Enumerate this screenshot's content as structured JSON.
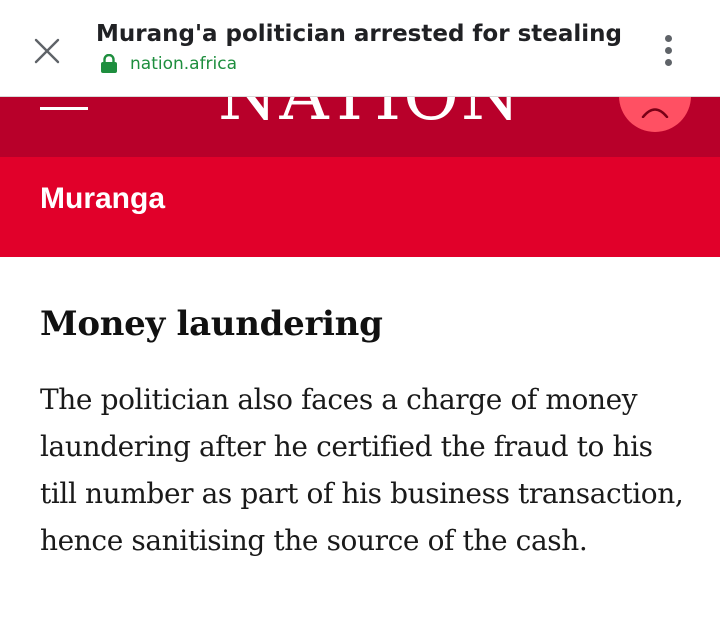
{
  "browser": {
    "page_title": "Murang'a politician arrested for stealing",
    "url": "nation.africa",
    "close_icon": "close-icon",
    "lock_icon": "lock-icon",
    "menu_icon": "more-vert-icon"
  },
  "site_header": {
    "logo_text": "NATION",
    "menu_icon": "hamburger-icon",
    "user_icon": "user-icon"
  },
  "section": {
    "label": "Muranga"
  },
  "article": {
    "subheading": "Money laundering",
    "paragraph": "The politician also faces a charge of money laundering after he certified the fraud to his till number as part of his business transaction, hence sanitising the source of the cash."
  },
  "colors": {
    "header_dark_red": "#b8002a",
    "section_red": "#e1002a",
    "user_button": "#ff5063",
    "url_green": "#1e8e3e"
  }
}
